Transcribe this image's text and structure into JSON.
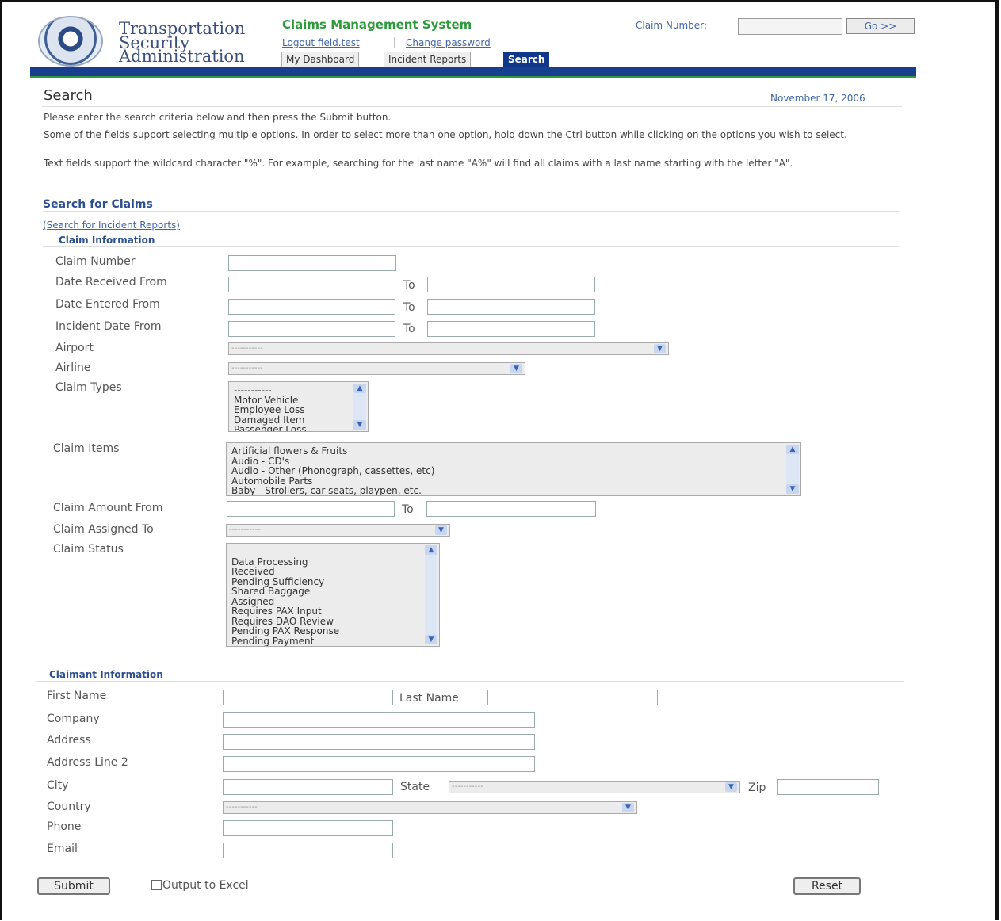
{
  "header": {
    "brand_lines": [
      "Transportation",
      "Security",
      "Administration"
    ],
    "app_name": "Claims Management System",
    "logout_link": "Logout field.test",
    "separator": "|",
    "change_password_link": "Change password",
    "claim_number_label": "Claim Number:",
    "claim_number_value": "",
    "go_button": "Go >>",
    "tabs": [
      {
        "label": "My Dashboard",
        "active": false
      },
      {
        "label": "Incident Reports",
        "active": false
      },
      {
        "label": "Search",
        "active": true
      }
    ]
  },
  "page": {
    "title": "Search",
    "date": "November 17, 2006",
    "instructions": [
      "Please enter the search criteria below and then press the Submit button.",
      "Some of the fields support selecting multiple options. In order to select more than one option, hold down the Ctrl button while clicking on the options you wish to select.",
      "Text fields support the wildcard character \"%\". For example, searching for the last name \"A%\" will find all claims with a last name starting with the letter \"A\"."
    ],
    "section_title": "Search for Claims",
    "incident_link": "(Search for Incident Reports)"
  },
  "claim_info": {
    "heading": "Claim Information",
    "claim_number_label": "Claim Number",
    "date_received_label": "Date Received From",
    "date_entered_label": "Date Entered From",
    "incident_date_label": "Incident Date From",
    "to_label": "To",
    "airport_label": "Airport",
    "airline_label": "Airline",
    "claim_types_label": "Claim Types",
    "claim_items_label": "Claim Items",
    "claim_amount_label": "Claim Amount From",
    "assigned_to_label": "Claim Assigned To",
    "claim_status_label": "Claim Status",
    "select_placeholder": "-----------",
    "claim_types_options": [
      "-----------",
      "Motor Vehicle",
      "Employee Loss",
      "Damaged Item",
      "Passenger Loss"
    ],
    "claim_items_options": [
      "Artificial flowers & Fruits",
      "Audio - CD's",
      "Audio - Other (Phonograph, cassettes, etc)",
      "Automobile Parts",
      "Baby - Strollers, car seats, playpen, etc."
    ],
    "claim_status_options": [
      "-----------",
      "Data Processing",
      "Received",
      "Pending Sufficiency",
      "Shared Baggage",
      "Assigned",
      "Requires PAX Input",
      "Requires DAO Review",
      "Pending PAX Response",
      "Pending Payment"
    ]
  },
  "claimant_info": {
    "heading": "Claimant Information",
    "first_name_label": "First Name",
    "last_name_label": "Last Name",
    "company_label": "Company",
    "address_label": "Address",
    "address2_label": "Address Line 2",
    "city_label": "City",
    "state_label": "State",
    "zip_label": "Zip",
    "country_label": "Country",
    "phone_label": "Phone",
    "email_label": "Email"
  },
  "actions": {
    "submit": "Submit",
    "output_excel": "Output to Excel",
    "reset": "Reset"
  }
}
